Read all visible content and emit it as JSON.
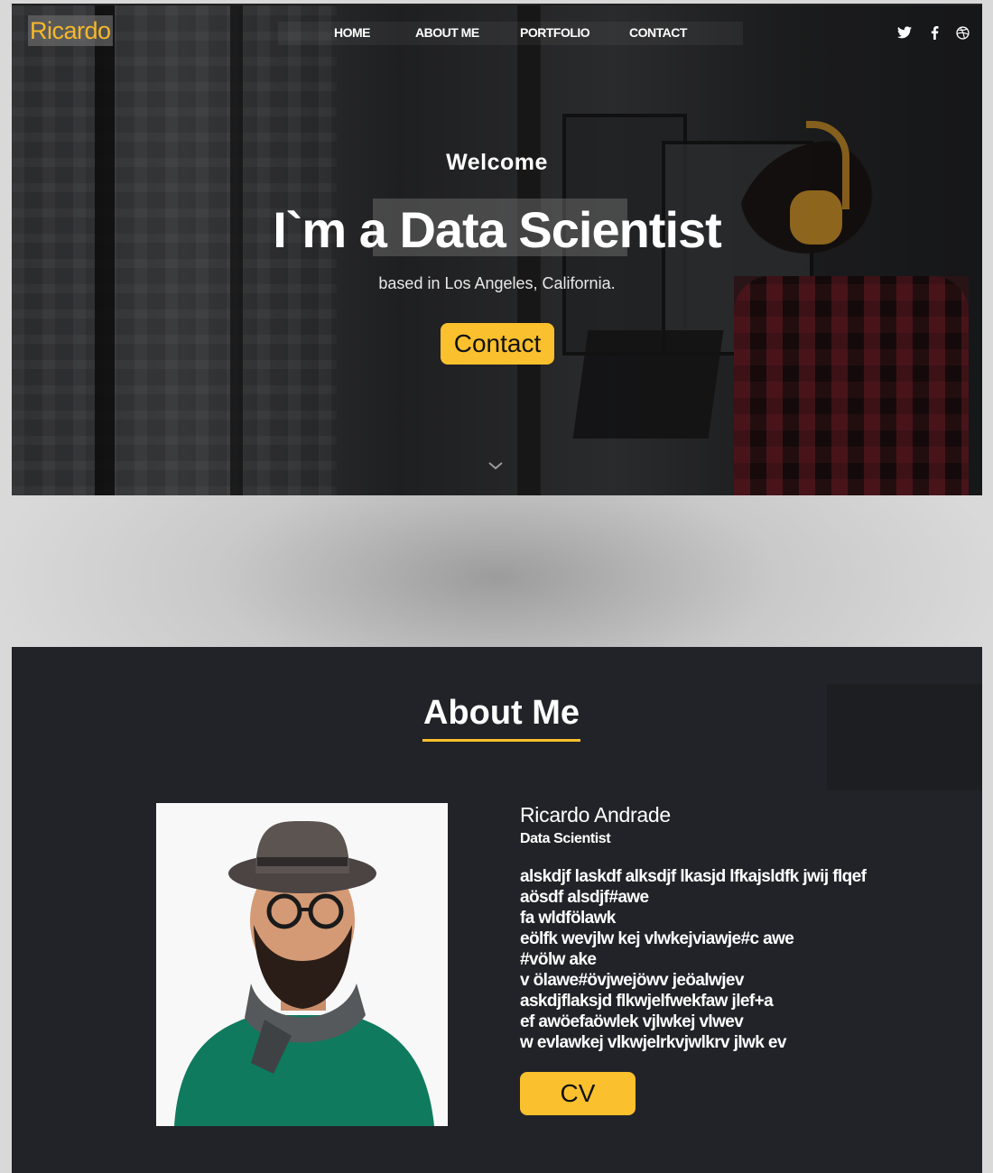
{
  "header": {
    "logo": "Ricardo",
    "nav": [
      "HOME",
      "ABOUT ME",
      "PORTFOLIO",
      "CONTACT"
    ],
    "social_icons": [
      "twitter-icon",
      "facebook-icon",
      "dribbble-icon"
    ]
  },
  "hero": {
    "welcome": "Welcome",
    "title": "I`m a Data Scientist",
    "subtitle": "based in Los Angeles, California.",
    "cta": "Contact",
    "scroll_icon": "chevron-down-icon"
  },
  "about": {
    "heading": "About Me",
    "name": "Ricardo Andrade",
    "role": "Data Scientist",
    "bio_lines": [
      "alskdjf laskdf alksdjf lkasjd lfkajsldfk jwij flqef",
      "aösdf alsdjf#awe",
      "fa wldfölawk",
      "eölfk wevjlw kej vlwkejviawje#c awe",
      "#völw ake",
      "v ölawe#övjwejöwv jeöalwjev",
      "askdjflaksjd flkwjelfwekfaw jlef+a",
      "ef awöefaöwlek vjlwkej vlwev",
      "w evlawkej vlkwjelrkvjwlkrv jlwk ev"
    ],
    "cv_button": "CV"
  },
  "colors": {
    "accent": "#fbc02d",
    "section_bg": "#212328",
    "text": "#ffffff"
  }
}
